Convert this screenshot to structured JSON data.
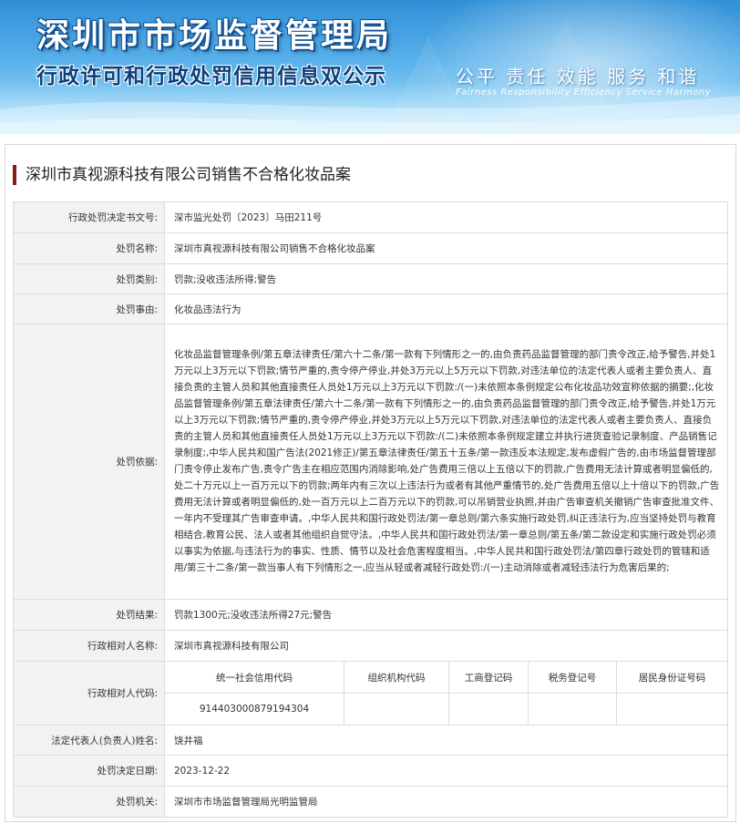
{
  "banner": {
    "bureau_name": "深圳市市场监督管理局",
    "subtitle": "行政许可和行政处罚信用信息双公示",
    "slogan": "公平  责任  效能  服务  和谐",
    "slogan_en": "Fairness  Responsibility  Efficiency  Service  Harmony"
  },
  "case": {
    "title": "深圳市真视源科技有限公司销售不合格化妆品案"
  },
  "rows": {
    "decision_no": {
      "label": "行政处罚决定书文号:",
      "value": "深市监光处罚〔2023〕马田211号"
    },
    "penalty_name": {
      "label": "处罚名称:",
      "value": "深圳市真视源科技有限公司销售不合格化妆品案"
    },
    "penalty_type": {
      "label": "处罚类别:",
      "value": "罚款;没收违法所得;警告"
    },
    "penalty_reason": {
      "label": "处罚事由:",
      "value": "化妆品违法行为"
    },
    "penalty_basis": {
      "label": "处罚依据:",
      "value": "化妆品监督管理条例/第五章法律责任/第六十二条/第一款有下列情形之一的,由负责药品监督管理的部门责令改正,给予警告,并处1万元以上3万元以下罚款;情节严重的,责令停产停业,并处3万元以上5万元以下罚款,对违法单位的法定代表人或者主要负责人、直接负责的主管人员和其他直接责任人员处1万元以上3万元以下罚款:/(一)未依照本条例规定公布化妆品功效宣称依据的摘要;,化妆品监督管理条例/第五章法律责任/第六十二条/第一款有下列情形之一的,由负责药品监督管理的部门责令改正,给予警告,并处1万元以上3万元以下罚款;情节严重的,责令停产停业,并处3万元以上5万元以下罚款,对违法单位的法定代表人或者主要负责人、直接负责的主管人员和其他直接责任人员处1万元以上3万元以下罚款:/(二)未依照本条例规定建立并执行进货查验记录制度、产品销售记录制度;,中华人民共和国广告法(2021修正)/第五章法律责任/第五十五条/第一款违反本法规定,发布虚假广告的,由市场监督管理部门责令停止发布广告,责令广告主在相应范围内消除影响,处广告费用三倍以上五倍以下的罚款,广告费用无法计算或者明显偏低的,处二十万元以上一百万元以下的罚款;两年内有三次以上违法行为或者有其他严重情节的,处广告费用五倍以上十倍以下的罚款,广告费用无法计算或者明显偏低的,处一百万元以上二百万元以下的罚款,可以吊销营业执照,并由广告审查机关撤销广告审查批准文件、一年内不受理其广告审查申请。,中华人民共和国行政处罚法/第一章总则/第六条实施行政处罚,纠正违法行为,应当坚持处罚与教育相结合,教育公民、法人或者其他组织自觉守法。,中华人民共和国行政处罚法/第一章总则/第五条/第二款设定和实施行政处罚必须以事实为依据,与违法行为的事实、性质、情节以及社会危害程度相当。,中华人民共和国行政处罚法/第四章行政处罚的管辖和适用/第三十二条/第一款当事人有下列情形之一,应当从轻或者减轻行政处罚:/(一)主动消除或者减轻违法行为危害后果的;"
    },
    "penalty_result": {
      "label": "处罚结果:",
      "value": "罚款1300元;没收违法所得27元;警告"
    },
    "counterpart_name": {
      "label": "行政相对人名称:",
      "value": "深圳市真视源科技有限公司"
    },
    "counterpart_code": {
      "label": "行政相对人代码:",
      "headers": [
        "统一社会信用代码",
        "组织机构代码",
        "工商登记码",
        "税务登记号",
        "居民身份证号码"
      ],
      "values": [
        "914403000879194304",
        "",
        "",
        "",
        ""
      ]
    },
    "legal_rep": {
      "label": "法定代表人(负责人)姓名:",
      "value": "饶井福"
    },
    "decision_date": {
      "label": "处罚决定日期:",
      "value": "2023-12-22"
    },
    "authority": {
      "label": "处罚机关:",
      "value": "深圳市市场监督管理局光明监管局"
    }
  },
  "colors": {
    "banner_top": "#2f8fd6",
    "banner_bottom": "#bfe6fa",
    "title_accent": "#8b1a1a",
    "label_bg": "#f2f2f2",
    "border": "#dcdcdc"
  }
}
